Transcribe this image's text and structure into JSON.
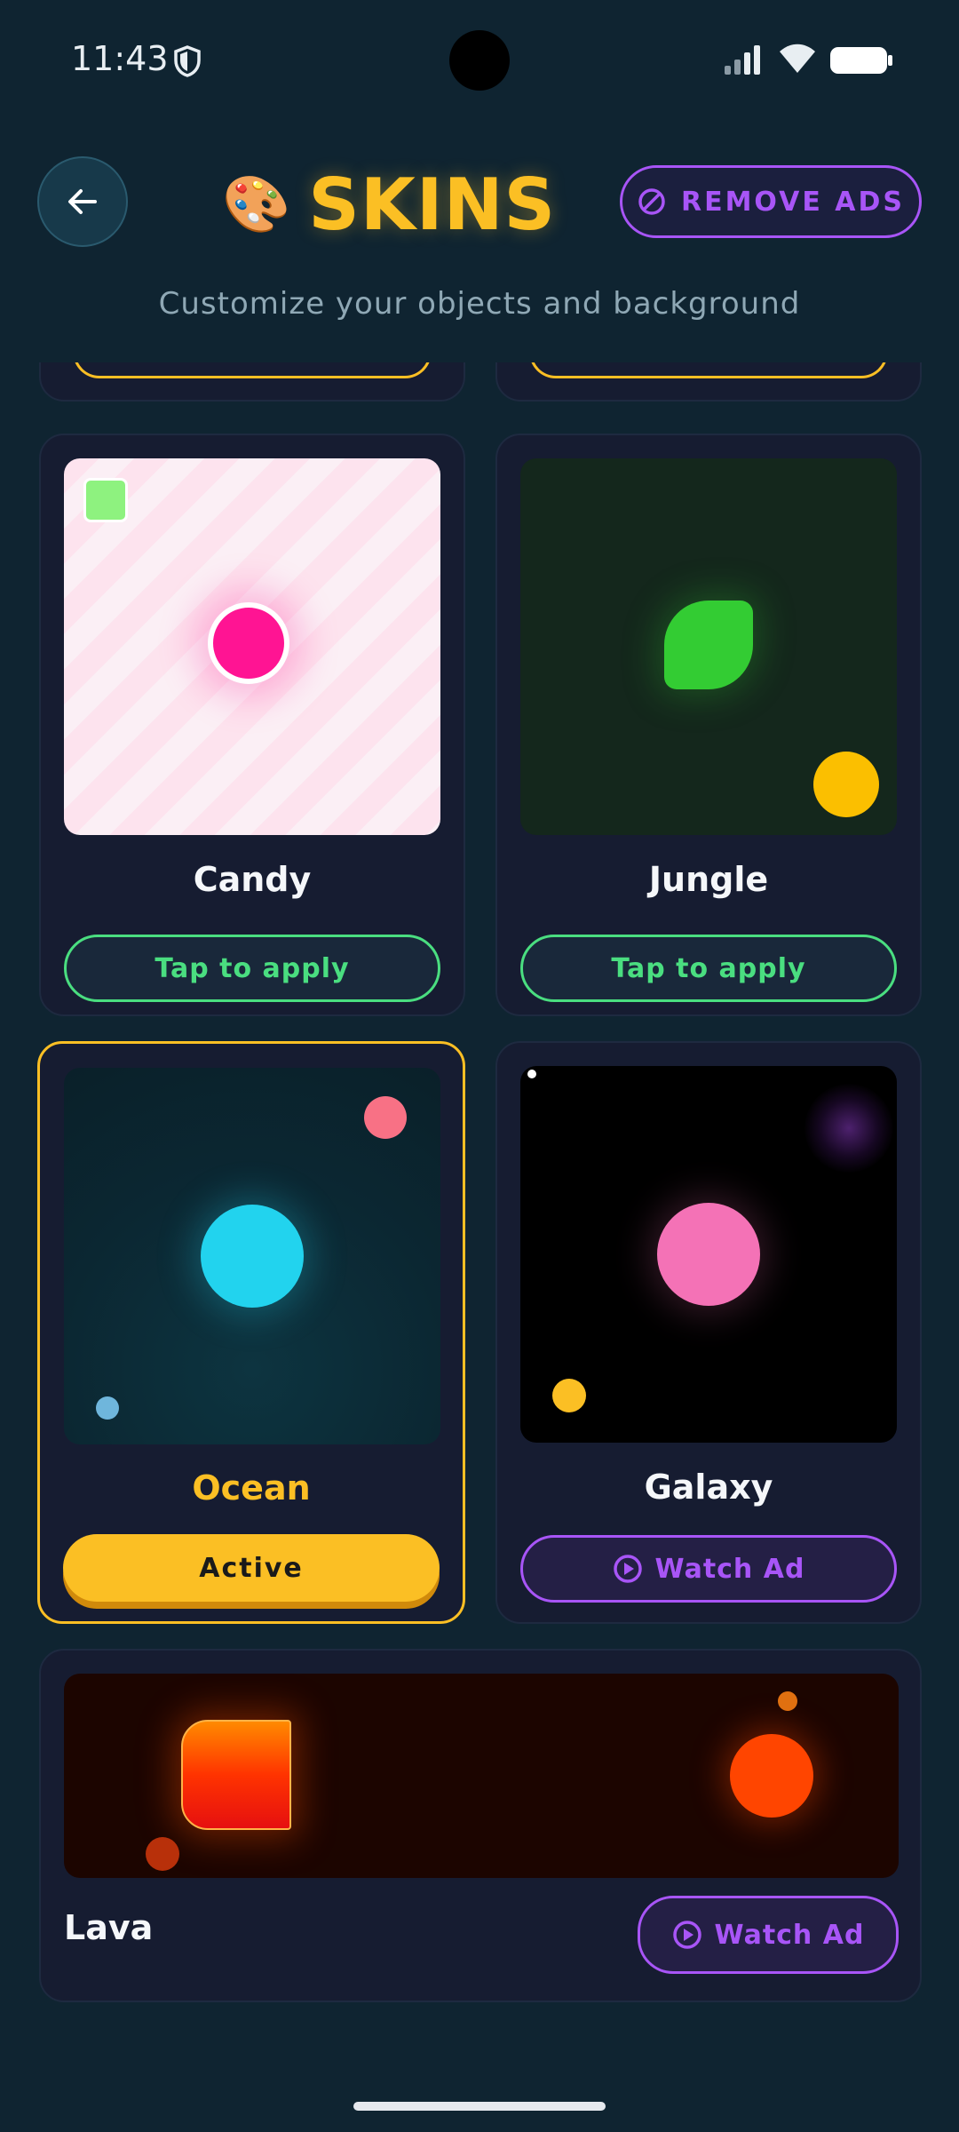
{
  "status_bar": {
    "time": "11:43"
  },
  "header": {
    "title_emoji": "🎨",
    "title": "SKINS",
    "remove_ads_label": "REMOVE ADS",
    "subtitle": "Customize your objects and background"
  },
  "skins": [
    {
      "name": "Candy",
      "button_label": "Tap to apply",
      "state": "available"
    },
    {
      "name": "Jungle",
      "button_label": "Tap to apply",
      "state": "available"
    },
    {
      "name": "Ocean",
      "button_label": "Active",
      "state": "active"
    },
    {
      "name": "Galaxy",
      "button_label": "Watch Ad",
      "state": "locked"
    },
    {
      "name": "Lava",
      "button_label": "Watch Ad",
      "state": "locked"
    }
  ],
  "colors": {
    "accent_gold": "#fbbf24",
    "accent_purple": "#a855f7",
    "accent_green": "#4ade80",
    "background": "#0f2431",
    "card": "#161c31"
  }
}
